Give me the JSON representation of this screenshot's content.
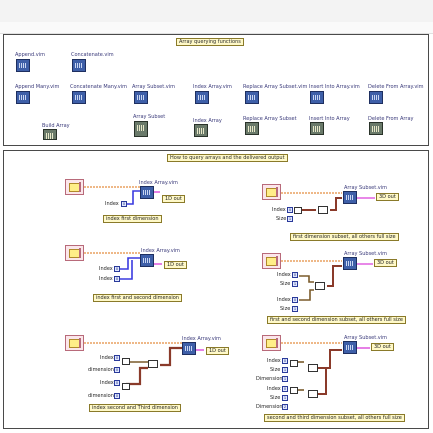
{
  "panel1": {
    "title": "Array querying functions",
    "items": [
      {
        "label": "Append.vim"
      },
      {
        "label": "Concatenate.vim"
      },
      {
        "label": "Append Many.vim"
      },
      {
        "label": "Concatenate Many.vim"
      },
      {
        "label": "Array Subset.vim"
      },
      {
        "label": "Index Array.vim"
      },
      {
        "label": "Replace Array Subset.vim"
      },
      {
        "label": "Insert Into Array.vim"
      },
      {
        "label": "Delete From Array.vim"
      },
      {
        "label": "Build Array"
      },
      {
        "label": "Array Subset"
      },
      {
        "label": "Index Array"
      },
      {
        "label": "Replace Array Subset"
      },
      {
        "label": "Insert Into Array"
      },
      {
        "label": "Delete From Array"
      }
    ]
  },
  "panel2": {
    "title": "How to query arrays and the delivered output",
    "examples": [
      {
        "vi": "Index Array.vim",
        "out": "1D out",
        "caption": "index first dimension",
        "inputs": [
          "Index"
        ]
      },
      {
        "vi": "Index Array.vim",
        "out": "1D out",
        "caption": "index first and second dimension",
        "inputs": [
          "Index",
          "Index"
        ]
      },
      {
        "vi": "Index Array.vim",
        "out": "1D out",
        "caption": "index second and Third dimension",
        "inputs": [
          "Index",
          "dimension",
          "Index",
          "dimension"
        ]
      },
      {
        "vi": "Array Subset.vim",
        "out": "3D out",
        "caption": "first dimension subset, all others full size",
        "inputs": [
          "Index",
          "Size"
        ]
      },
      {
        "vi": "Array Subset.vim",
        "out": "3D out",
        "caption": "first and second dimension subset, all others full size",
        "inputs": [
          "Index",
          "Size",
          "Index",
          "Size"
        ]
      },
      {
        "vi": "Array Subset.vim",
        "out": "3D out",
        "caption": "second and third dimension subset, all others full size",
        "inputs": [
          "Index",
          "Size",
          "Dimension",
          "Index",
          "Size",
          "Dimension"
        ]
      }
    ]
  }
}
